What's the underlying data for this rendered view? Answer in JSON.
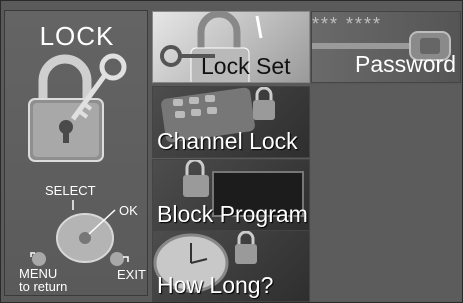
{
  "left_panel": {
    "title": "LOCK",
    "select_label": "SELECT",
    "ok_label": "OK",
    "menu_label": "MENU",
    "menu_sub_label": "to return",
    "exit_label": "EXIT"
  },
  "menu": {
    "items": [
      {
        "label": "Lock Set",
        "icon": "padlock-key-icon",
        "selected": true
      },
      {
        "label": "Channel Lock",
        "icon": "remote-padlock-icon",
        "selected": false
      },
      {
        "label": "Block Program",
        "icon": "tv-padlock-icon",
        "selected": false
      },
      {
        "label": "How Long?",
        "icon": "clock-padlock-icon",
        "selected": false
      }
    ]
  },
  "password_tile": {
    "stars": "*** ****",
    "label": "Password",
    "icon": "key-icon"
  },
  "colors": {
    "panel": "#5a5a5a",
    "tile_dark": "#2e2e2e",
    "tile_selected": "#d8d8d8"
  }
}
